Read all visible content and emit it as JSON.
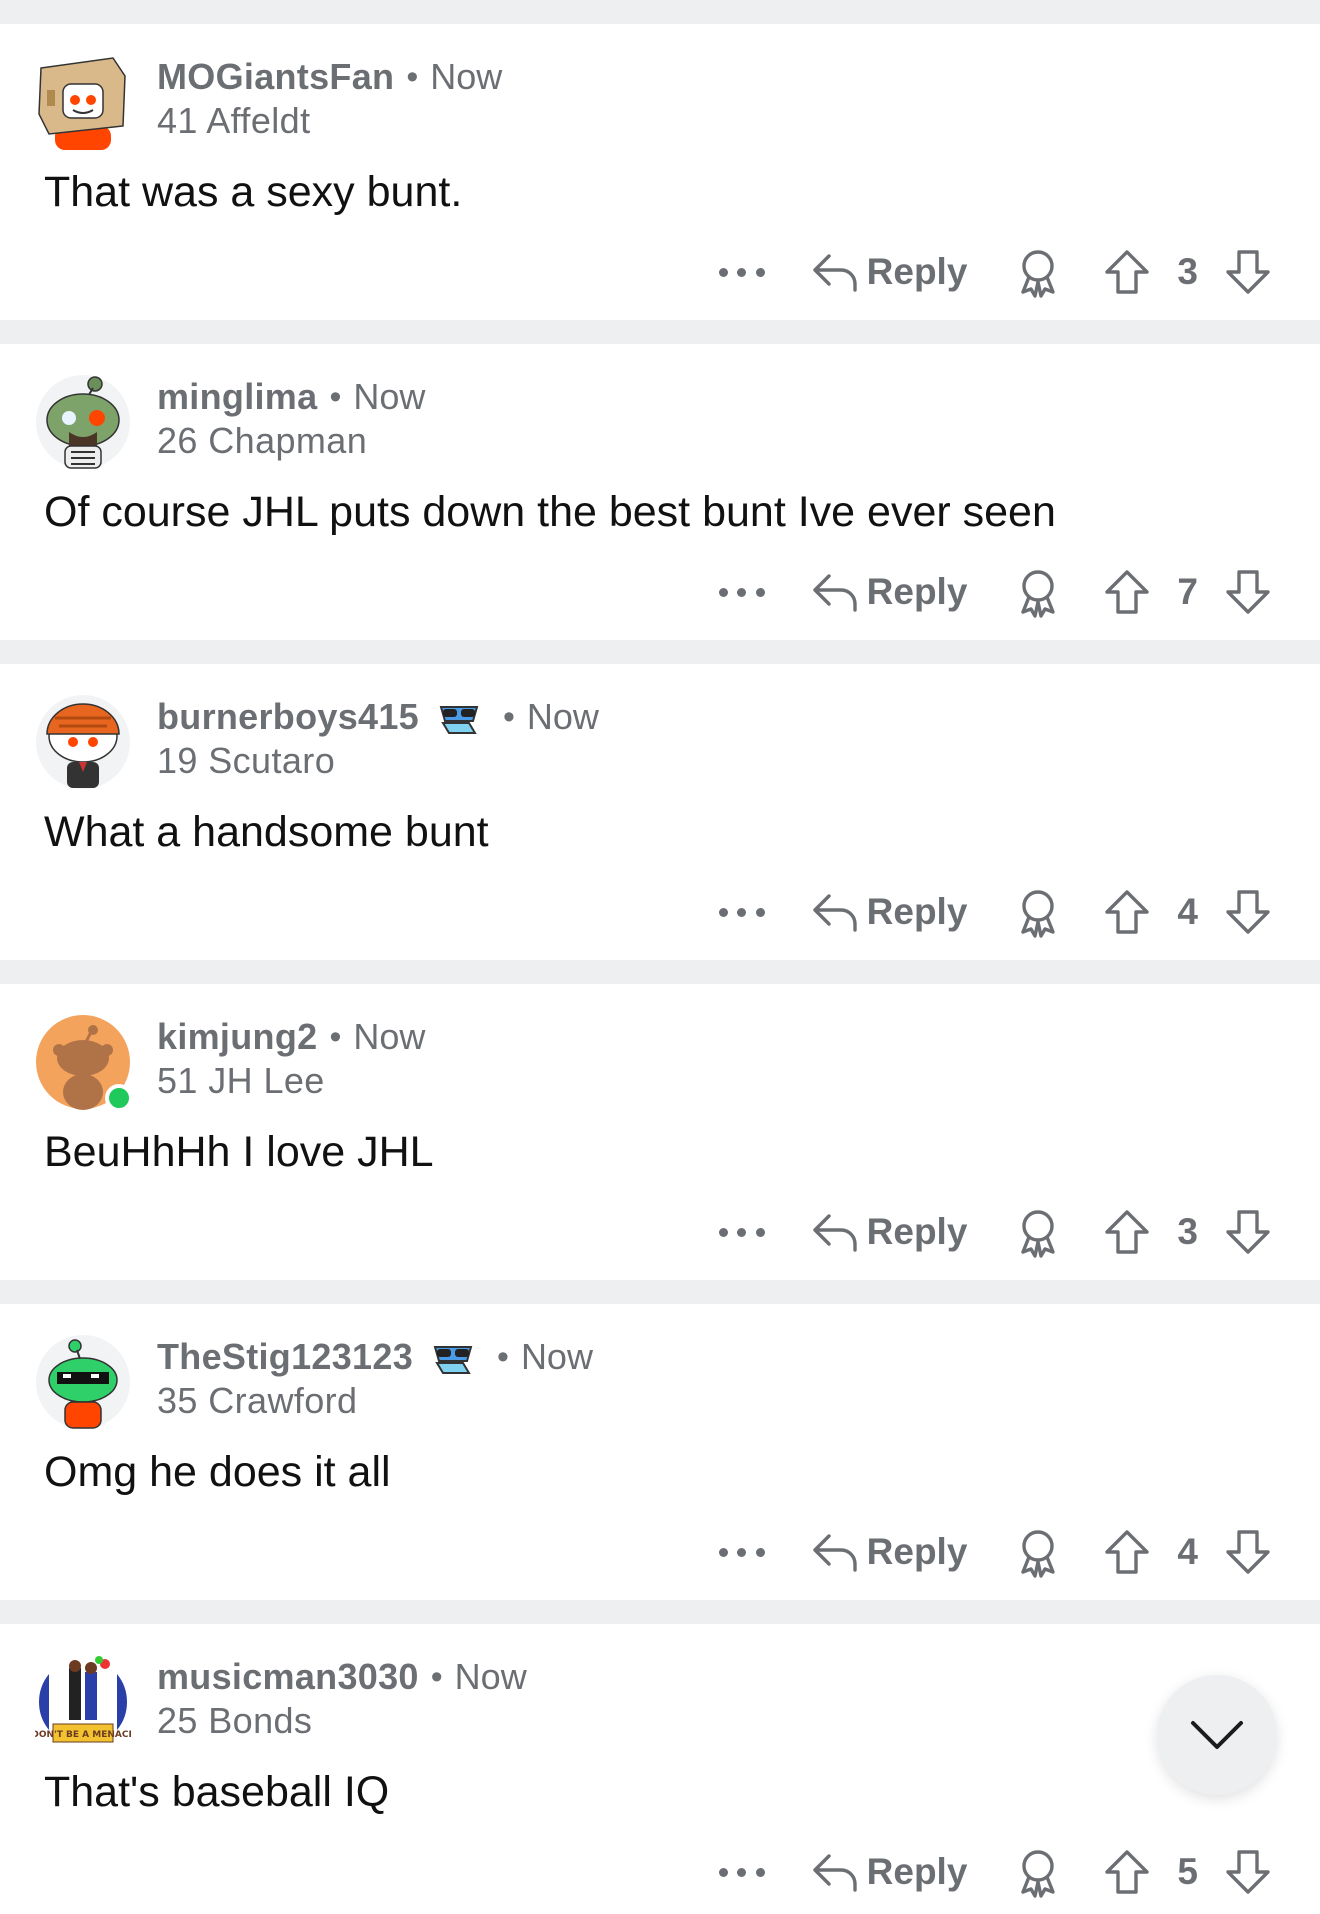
{
  "comments": [
    {
      "username": "MOGiantsFan",
      "separator": "•",
      "time": "Now",
      "flair": "41 Affeldt",
      "body": "That was a sexy bunt.",
      "score": "3",
      "reply_label": "Reply",
      "avatar": "box-head-snoo-avatar",
      "has_badge": false
    },
    {
      "username": "minglima",
      "separator": "•",
      "time": "Now",
      "flair": "26 Chapman",
      "body": "Of course JHL puts down the best bunt Ive ever seen",
      "score": "7",
      "reply_label": "Reply",
      "avatar": "zombie-snoo-avatar",
      "has_badge": false
    },
    {
      "username": "burnerboys415",
      "separator": "•",
      "time": "Now",
      "flair": "19 Scutaro",
      "body": "What a handsome bunt",
      "score": "4",
      "reply_label": "Reply",
      "avatar": "helmet-snoo-avatar",
      "has_badge": true
    },
    {
      "username": "kimjung2",
      "separator": "•",
      "time": "Now",
      "flair": "51 JH Lee",
      "body": "BeuHhHh I love JHL",
      "score": "3",
      "reply_label": "Reply",
      "avatar": "default-snoo-avatar",
      "has_badge": false
    },
    {
      "username": "TheStig123123",
      "separator": "•",
      "time": "Now",
      "flair": "35 Crawford",
      "body": "Omg he does it all",
      "score": "4",
      "reply_label": "Reply",
      "avatar": "sunglasses-snoo-avatar",
      "has_badge": true
    },
    {
      "username": "musicman3030",
      "separator": "•",
      "time": "Now",
      "flair": "25 Bonds",
      "body": "That's baseball IQ",
      "score": "5",
      "reply_label": "Reply",
      "avatar": "dont-menace-avatar",
      "has_badge": false
    }
  ],
  "avatar_logo_text": "DON'T BE A MENACE",
  "colors": {
    "meta_gray": "#6b6e72",
    "divider": "#edeff1",
    "online": "#1fc95b",
    "snoo_orange": "#ff4500"
  },
  "icons": [
    "more-icon",
    "reply-icon",
    "award-icon",
    "upvote-icon",
    "downvote-icon",
    "chevron-down-icon",
    "badge-icon"
  ]
}
